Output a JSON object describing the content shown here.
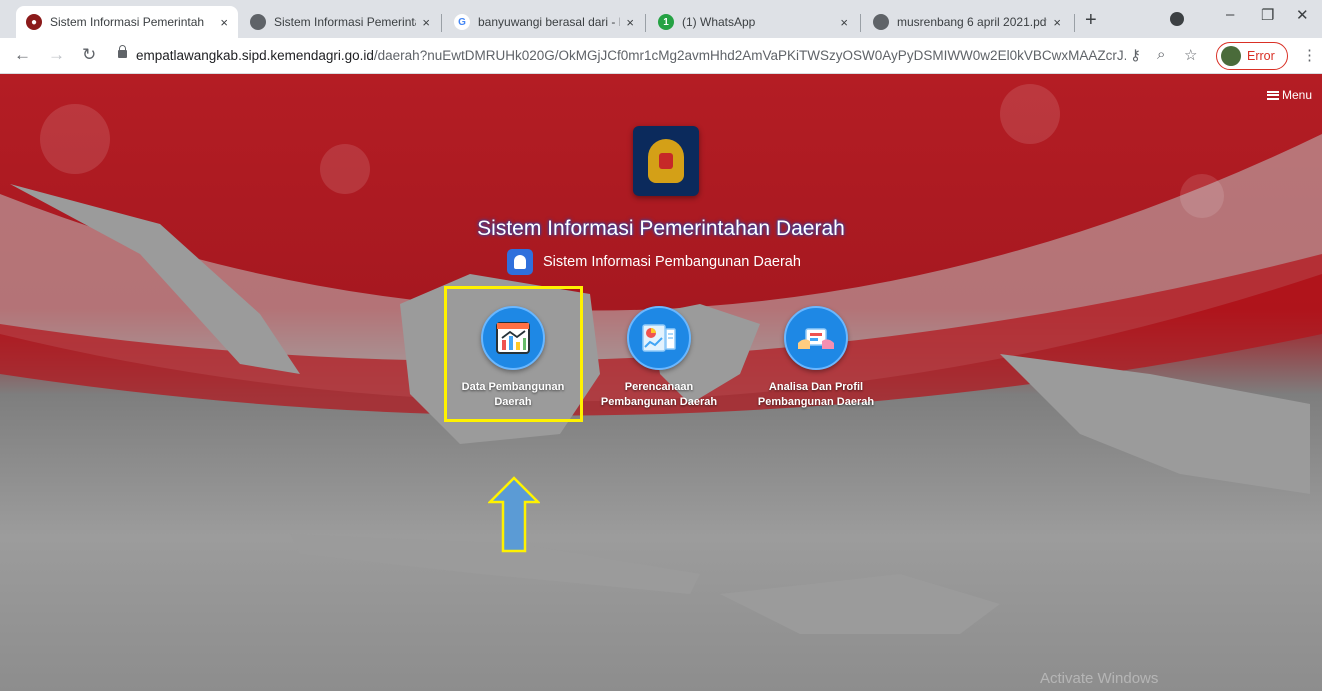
{
  "browser": {
    "tabs": [
      {
        "title": "Sistem Informasi Pemerintah",
        "active": true
      },
      {
        "title": "Sistem Informasi Pemerintah",
        "active": false
      },
      {
        "title": "banyuwangi berasal dari - Pe",
        "active": false
      },
      {
        "title": "(1) WhatsApp",
        "active": false
      },
      {
        "title": "musrenbang 6 april 2021.pdf",
        "active": false
      }
    ],
    "close_glyph": "×",
    "new_tab_glyph": "+",
    "url_host": "empatlawangkab.sipd.kemendagri.go.id",
    "url_path": "/daerah?nuEwtDMRUHk020G/OkMGjJCf0mr1cMg2avmHhd2AmVaPKiTWSzyOSW0AyPyDSMIWW0w2El0kVBCwxMAAZcrJ...",
    "profile_status": "Error"
  },
  "page": {
    "menu_label": "Menu",
    "title": "Sistem Informasi Pemerintahan Daerah",
    "subtitle": "Sistem Informasi Pembangunan Daerah",
    "items": [
      {
        "label_line1": "Data Pembangunan",
        "label_line2": "Daerah",
        "icon": "data-chart-icon"
      },
      {
        "label_line1": "Perencanaan",
        "label_line2": "Pembangunan Daerah",
        "icon": "planning-report-icon"
      },
      {
        "label_line1": "Analisa Dan Profil",
        "label_line2": "Pembangunan Daerah",
        "icon": "analysis-profile-icon"
      }
    ],
    "watermark": "Activate Windows"
  },
  "colors": {
    "background_red": "#b41d24",
    "icon_blue": "#1e88e5",
    "highlight_yellow": "#fff200",
    "arrow_blue": "#5b9bd5"
  }
}
